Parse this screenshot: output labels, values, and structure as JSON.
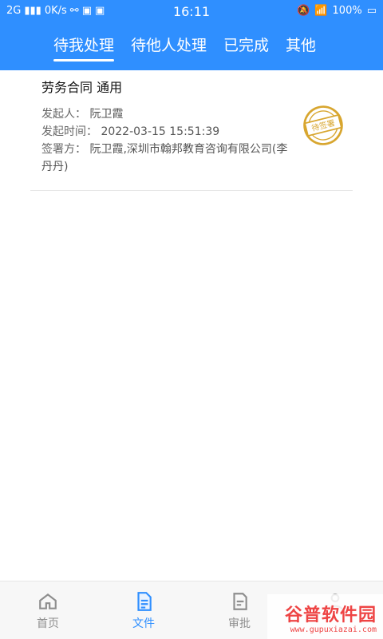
{
  "status_bar": {
    "network": "2G",
    "speed": "0K/s",
    "time": "16:11",
    "battery": "100%"
  },
  "tabs": [
    {
      "label": "待我处理",
      "active": true
    },
    {
      "label": "待他人处理",
      "active": false
    },
    {
      "label": "已完成",
      "active": false
    },
    {
      "label": "其他",
      "active": false
    }
  ],
  "card": {
    "title": "劳务合同 通用",
    "initiator_label": "发起人：",
    "initiator": "阮卫霞",
    "time_label": "发起时间：",
    "time": "2022-03-15 15:51:39",
    "signers_label": "签署方：",
    "signers": "阮卫霞,深圳市翰邦教育咨询有限公司(李丹丹)",
    "stamp_text": "待签署"
  },
  "bottom_nav": [
    {
      "label": "首页",
      "icon": "home-icon",
      "active": false
    },
    {
      "label": "文件",
      "icon": "document-icon",
      "active": true
    },
    {
      "label": "审批",
      "icon": "approval-icon",
      "active": false
    },
    {
      "label": "",
      "icon": "profile-icon",
      "active": false
    }
  ],
  "watermark": {
    "brand": "谷普软件园",
    "url": "www.gupuxiazai.com"
  },
  "colors": {
    "primary": "#2f8fff",
    "stamp": "#d8a62f",
    "watermark": "#e44444"
  }
}
